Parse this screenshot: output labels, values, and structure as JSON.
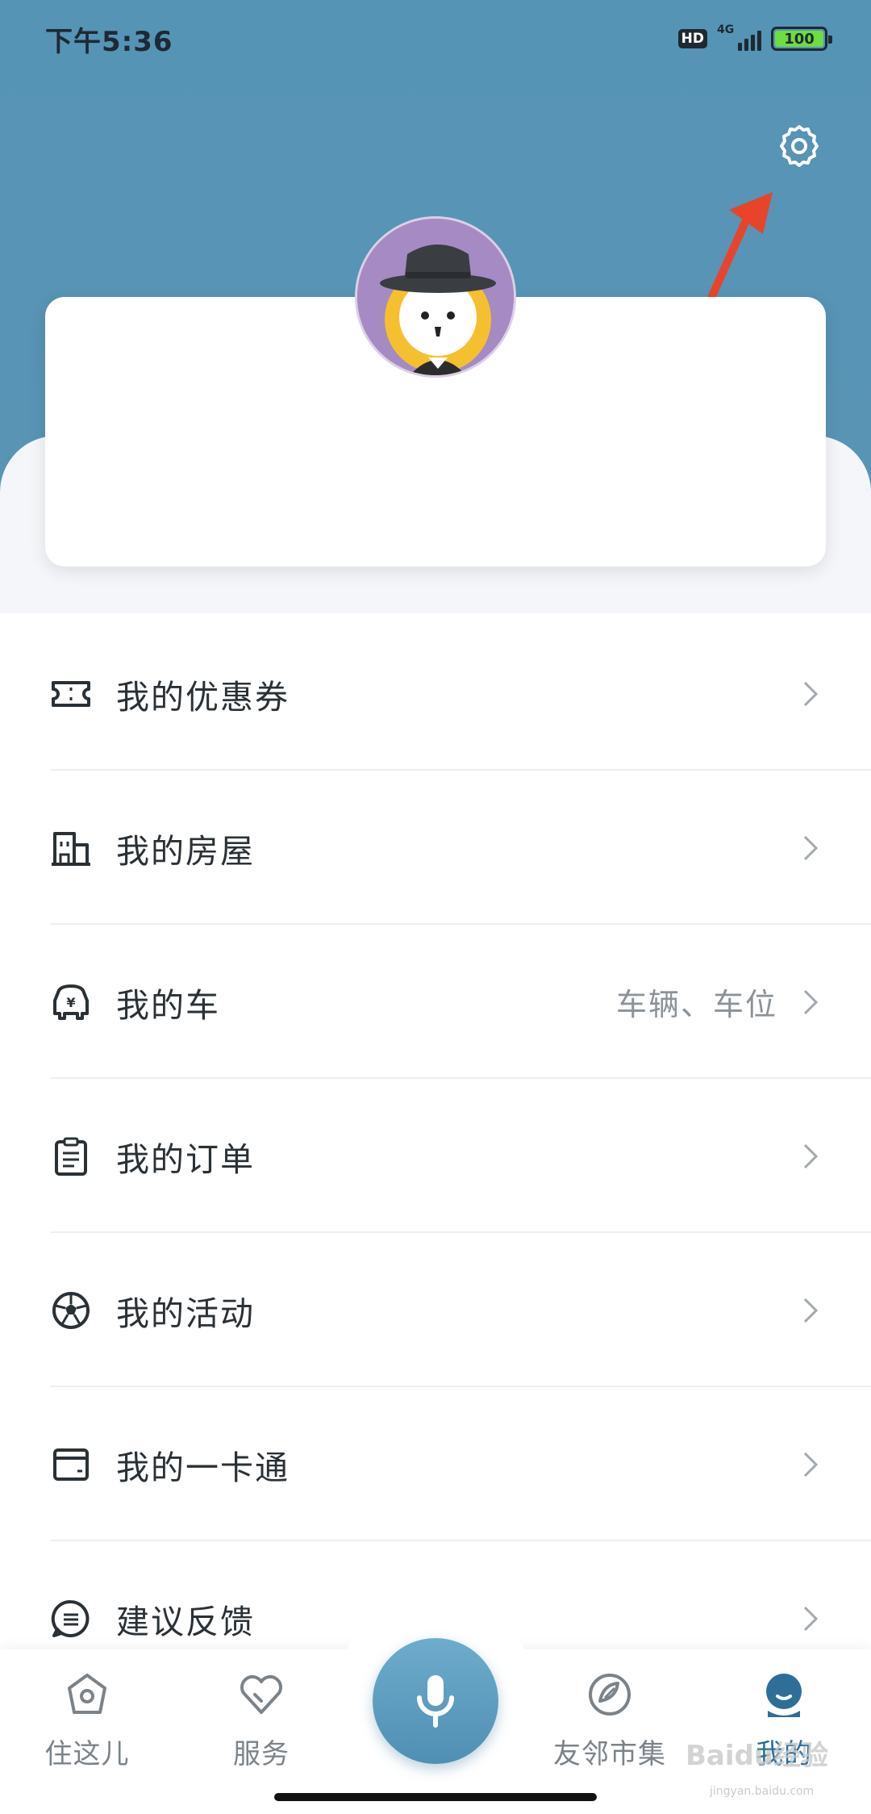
{
  "status_bar": {
    "time": "下午5:36",
    "hd": "HD",
    "network": "4G",
    "battery": "100"
  },
  "header": {
    "settings_icon": "gear-icon"
  },
  "menu": {
    "items": [
      {
        "label": "我的优惠券",
        "icon": "ticket-icon",
        "extra": ""
      },
      {
        "label": "我的房屋",
        "icon": "building-icon",
        "extra": ""
      },
      {
        "label": "我的车",
        "icon": "car-icon",
        "extra": "车辆、车位"
      },
      {
        "label": "我的订单",
        "icon": "clipboard-icon",
        "extra": ""
      },
      {
        "label": "我的活动",
        "icon": "ball-icon",
        "extra": ""
      },
      {
        "label": "我的一卡通",
        "icon": "card-icon",
        "extra": ""
      },
      {
        "label": "建议反馈",
        "icon": "message-icon",
        "extra": ""
      }
    ]
  },
  "tabbar": {
    "tabs": [
      {
        "label": "住这儿",
        "icon": "home-icon"
      },
      {
        "label": "服务",
        "icon": "heart-icon"
      },
      {
        "label": "友邻市集",
        "icon": "market-icon"
      },
      {
        "label": "我的",
        "icon": "profile-icon"
      }
    ],
    "voice_icon": "microphone-icon",
    "active_tab": "我的"
  },
  "watermark": {
    "text": "Baidu经验",
    "sub": "jingyan.baidu.com"
  },
  "colors": {
    "header": "#5694b6",
    "accent": "#2d6f97",
    "arrow": "#e8442b"
  }
}
